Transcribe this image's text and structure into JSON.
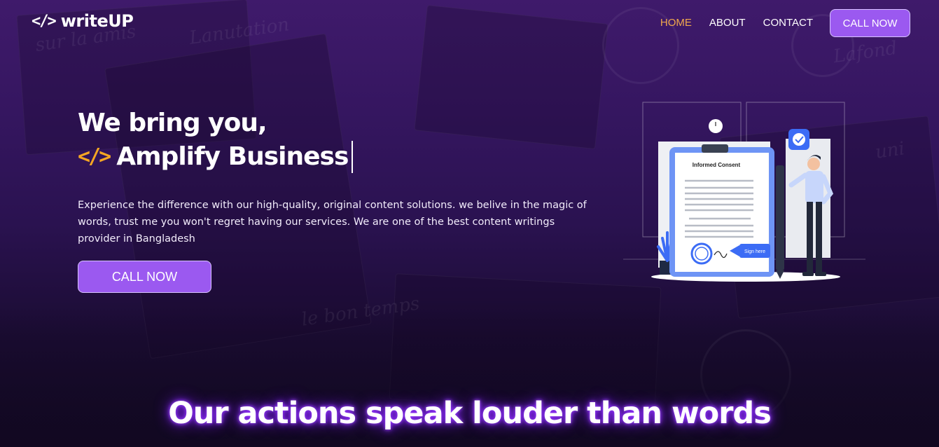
{
  "header": {
    "brand": "writeUP",
    "nav": [
      {
        "label": "HOME",
        "active": true
      },
      {
        "label": "ABOUT",
        "active": false
      },
      {
        "label": "CONTACT",
        "active": false
      }
    ],
    "cta_label": "CALL NOW"
  },
  "hero": {
    "title_line1": "We bring you,",
    "title_line2": "Amplify Business",
    "description": "Experience the difference with our high-quality, original content solutions. we belive in the magic of words, trust me you won't regret having our services. We are one of the best content writings provider in Bangladesh",
    "cta_label": "CALL NOW",
    "illustration": {
      "document_title": "Informed Consent",
      "sign_label": "Sign here"
    }
  },
  "tagline": "Our actions speak louder than words",
  "colors": {
    "accent": "#9b59f0",
    "active_nav": "#f0a84d",
    "code_icon_hero": "#f5a623",
    "glow": "#8f2bff"
  }
}
